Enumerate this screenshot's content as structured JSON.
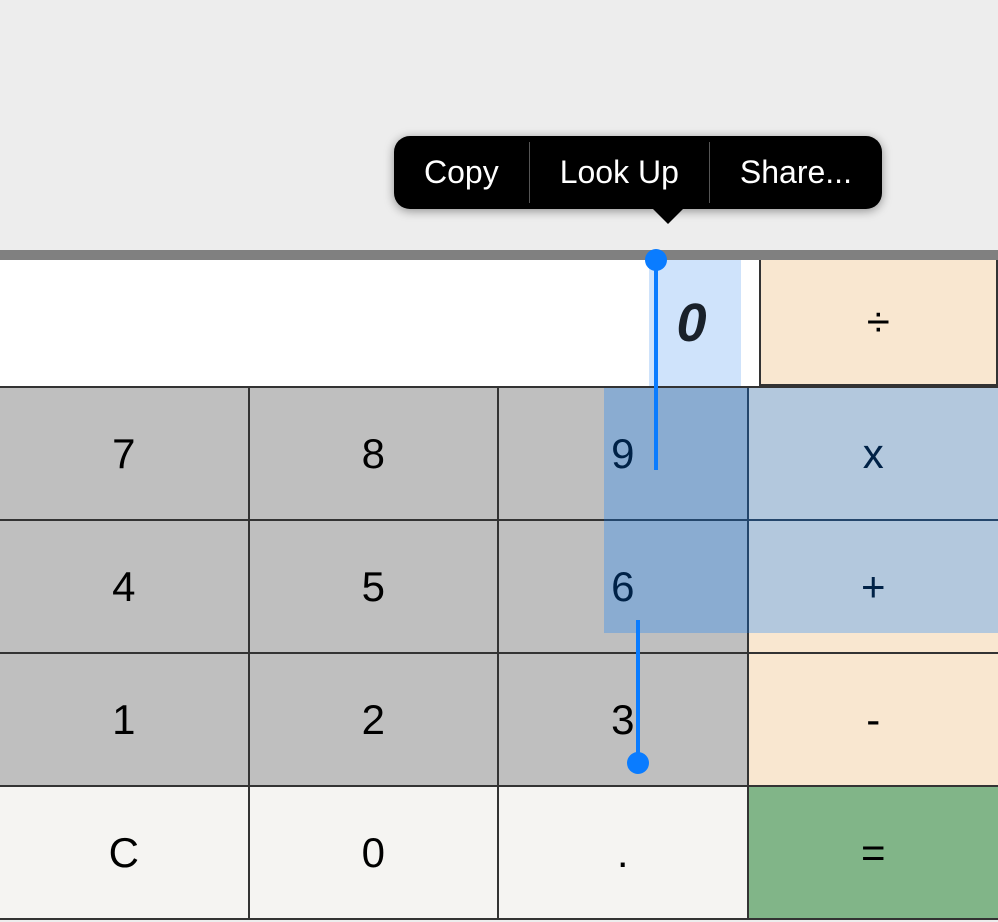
{
  "display": {
    "value": "0"
  },
  "ops": {
    "divide": "÷",
    "multiply": "x",
    "add": "+",
    "subtract": "-",
    "equals": "="
  },
  "digits": {
    "d7": "7",
    "d8": "8",
    "d9": "9",
    "d4": "4",
    "d5": "5",
    "d6": "6",
    "d1": "1",
    "d2": "2",
    "d3": "3",
    "d0": "0"
  },
  "clear": "C",
  "decimal": ".",
  "context_menu": {
    "copy": "Copy",
    "lookup": "Look Up",
    "share": "Share..."
  }
}
